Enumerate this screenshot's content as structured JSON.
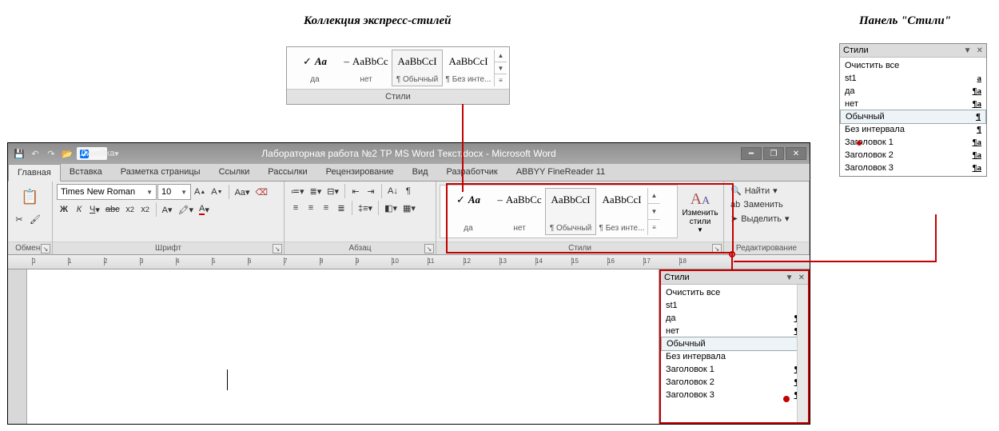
{
  "captions": {
    "quick_styles": "Коллекция экспресс-стилей",
    "styles_pane": "Панель \"Стили\""
  },
  "gallery": {
    "section": "Стили",
    "items": [
      {
        "preview": "Aa",
        "label": "да",
        "check": true
      },
      {
        "preview": "AaBbCc",
        "label": "нет",
        "prefix": "–"
      },
      {
        "preview": "AaBbCcI",
        "label": "¶ Обычный",
        "selected": true
      },
      {
        "preview": "AaBbCcI",
        "label": "¶ Без инте..."
      }
    ]
  },
  "pane": {
    "title": "Стили",
    "items": [
      {
        "name": "Очистить все",
        "sym": ""
      },
      {
        "name": "st1",
        "sym": "a"
      },
      {
        "name": "да",
        "sym": "¶a"
      },
      {
        "name": "нет",
        "sym": "¶a"
      },
      {
        "name": "Обычный",
        "sym": "¶",
        "selected": true
      },
      {
        "name": "Без интервала",
        "sym": "¶"
      },
      {
        "name": "Заголовок 1",
        "sym": "¶a"
      },
      {
        "name": "Заголовок 2",
        "sym": "¶a"
      },
      {
        "name": "Заголовок 3",
        "sym": "¶a"
      }
    ]
  },
  "window": {
    "ruler_label": "Линейка",
    "title": "Лабораторная работа №2 ТР MS Word Текст.docx - Microsoft Word",
    "tabs": [
      "Главная",
      "Вставка",
      "Разметка страницы",
      "Ссылки",
      "Рассылки",
      "Рецензирование",
      "Вид",
      "Разработчик",
      "ABBYY FineReader 11"
    ],
    "active_tab": 0,
    "clipboard_group": "Обмена",
    "font_group": "Шрифт",
    "font_name": "Times New Roman",
    "font_size": "10",
    "paragraph_group": "Абзац",
    "styles_group": "Стили",
    "change_styles": "Изменить стили",
    "editing_group": "Редактирование",
    "find": "Найти",
    "replace": "Заменить",
    "select": "Выделить"
  }
}
